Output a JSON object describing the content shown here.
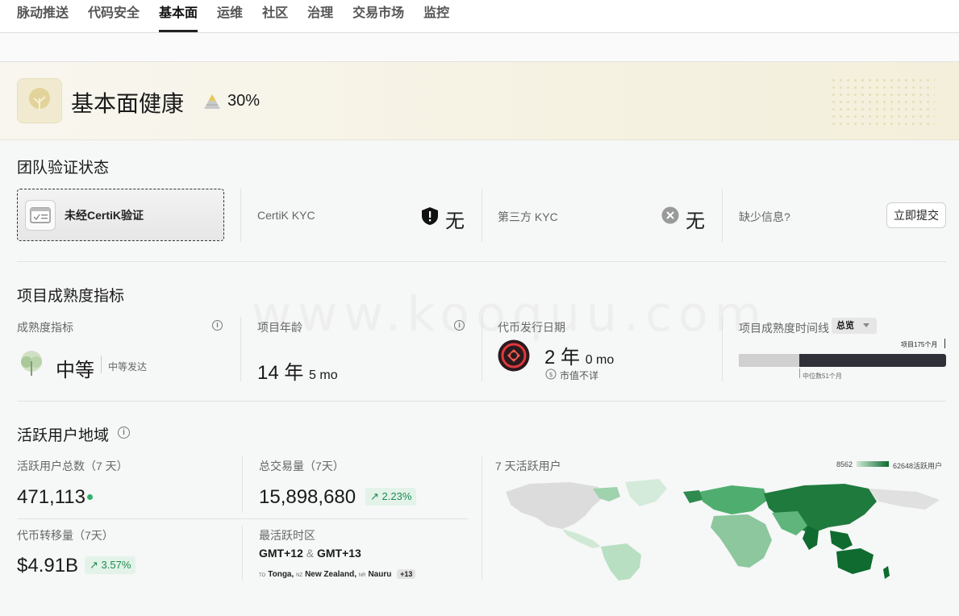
{
  "tabs": [
    "脉动推送",
    "代码安全",
    "基本面",
    "运维",
    "社区",
    "治理",
    "交易市场",
    "监控"
  ],
  "active_tab": "基本面",
  "hero": {
    "title": "基本面健康",
    "score": "30%"
  },
  "team_verification": {
    "title": "团队验证状态",
    "certik_label": "未经CertiK验证",
    "certik_kyc_label": "CertiK KYC",
    "certik_kyc_value": "无",
    "third_party_kyc_label": "第三方 KYC",
    "third_party_kyc_value": "无",
    "missing_info_label": "缺少信息?",
    "submit_button": "立即提交"
  },
  "maturity": {
    "title": "项目成熟度指标",
    "indicator_label": "成熟度指标",
    "indicator_value": "中等",
    "indicator_sub": "中等发达",
    "age_label": "项目年龄",
    "age_years": "14 年",
    "age_months": "5 mo",
    "token_date_label": "代币发行日期",
    "token_years": "2 年",
    "token_months": "0 mo",
    "market_cap_note": "市值不详",
    "timeline_label": "项目成熟度时间线",
    "timeline_dropdown": "总览",
    "timeline_project_label": "项目175个月",
    "timeline_median_label": "中位数51个月",
    "timeline_project_months": 175,
    "timeline_median_months": 51
  },
  "active_users": {
    "title": "活跃用户地域",
    "total_users_label": "活跃用户总数（7 天）",
    "total_users_value": "471,113",
    "volume_label": "总交易量（7天）",
    "volume_value": "15,898,680",
    "volume_delta": "2.23%",
    "transfer_label": "代币转移量（7天）",
    "transfer_value": "$4.91B",
    "transfer_delta": "3.57%",
    "timezone_label": "最活跃时区",
    "timezone_value_a": "GMT+12",
    "timezone_and": "&",
    "timezone_value_b": "GMT+13",
    "tz_countries": [
      {
        "code": "TO",
        "name": "Tonga"
      },
      {
        "code": "NZ",
        "name": "New Zealand"
      },
      {
        "code": "NR",
        "name": "Nauru"
      }
    ],
    "tz_more": "+13",
    "map_label": "7 天活跃用户",
    "legend_min": "8562",
    "legend_max": "62648活跃用户"
  },
  "watermark": "www.kooquu.com",
  "colors": {
    "accent_green": "#1f8a4c",
    "map_dark": "#0f6b30",
    "map_light": "#cfe9d6"
  }
}
